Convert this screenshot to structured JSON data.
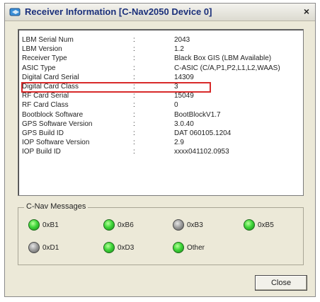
{
  "window": {
    "title": "Receiver Information [C-Nav2050 Device 0]",
    "close_glyph": "×"
  },
  "info": {
    "rows": [
      {
        "label": "LBM Serial Num",
        "value": "2043"
      },
      {
        "label": "LBM Version",
        "value": "1.2"
      },
      {
        "label": "Receiver Type",
        "value": "Black Box GIS (LBM Available)"
      },
      {
        "label": "ASIC Type",
        "value": "C-ASIC (C/A,P1,P2,L1,L2,WAAS)"
      },
      {
        "label": "Digital Card Serial",
        "value": "14309"
      },
      {
        "label": "Digital Card Class",
        "value": "3"
      },
      {
        "label": "RF Card Serial",
        "value": "15049"
      },
      {
        "label": "RF Card Class",
        "value": "0"
      },
      {
        "label": "Bootblock Software",
        "value": "BootBlockV1.7"
      },
      {
        "label": "GPS Software Version",
        "value": "3.0.40"
      },
      {
        "label": "GPS Build ID",
        "value": "DAT 060105.1204"
      },
      {
        "label": "IOP Software Version",
        "value": "2.9"
      },
      {
        "label": "IOP Build ID",
        "value": "xxxx041102.0953"
      }
    ],
    "separator": ":",
    "highlighted_row": "Digital Card Serial"
  },
  "messages": {
    "title": "C-Nav Messages",
    "items": [
      {
        "label": "0xB1",
        "state": "on"
      },
      {
        "label": "0xB6",
        "state": "on"
      },
      {
        "label": "0xB3",
        "state": "off"
      },
      {
        "label": "0xB5",
        "state": "on"
      },
      {
        "label": "0xD1",
        "state": "off"
      },
      {
        "label": "0xD3",
        "state": "on"
      },
      {
        "label": "Other",
        "state": "on"
      }
    ]
  },
  "buttons": {
    "close_label": "Close"
  },
  "colors": {
    "led_on": "#3fd63a",
    "led_off": "#9a9a9a",
    "highlight": "#d82a2a",
    "title_text": "#1a2f7a"
  }
}
